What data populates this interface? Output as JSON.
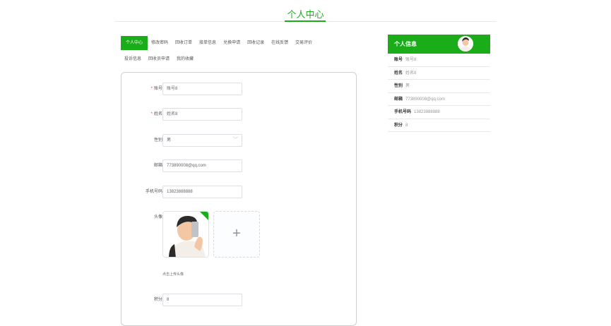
{
  "page": {
    "title": "个人中心"
  },
  "tabs": [
    {
      "label": "个人中心",
      "active": true
    },
    {
      "label": "修改密码"
    },
    {
      "label": "回收订单"
    },
    {
      "label": "接单信息"
    },
    {
      "label": "兑换申请"
    },
    {
      "label": "回收记录"
    },
    {
      "label": "在线反馈"
    },
    {
      "label": "交易评价"
    },
    {
      "label": "投诉信息"
    },
    {
      "label": "回收员申请"
    },
    {
      "label": "我的收藏"
    }
  ],
  "form": {
    "account": {
      "label": "账号",
      "value": "账号8"
    },
    "name": {
      "label": "姓名",
      "value": "姓名8"
    },
    "gender": {
      "label": "性别",
      "value": "男"
    },
    "email": {
      "label": "邮箱",
      "value": "773890008@qq.com"
    },
    "phone": {
      "label": "手机号码",
      "value": "13823888888"
    },
    "avatar": {
      "label": "头像",
      "upload_icon": "+",
      "hint": "点击上传头像"
    },
    "points": {
      "label": "积分",
      "value": "8"
    }
  },
  "sidebar": {
    "title": "个人信息",
    "rows": [
      {
        "key": "账号",
        "value": "账号8"
      },
      {
        "key": "姓名",
        "value": "姓名8"
      },
      {
        "key": "性别",
        "value": "男"
      },
      {
        "key": "邮箱",
        "value": "773890008@qq.com"
      },
      {
        "key": "手机号码",
        "value": "13823888888"
      },
      {
        "key": "积分",
        "value": "8"
      }
    ]
  },
  "colors": {
    "accent": "#1aad19",
    "required": "#ee3333"
  }
}
